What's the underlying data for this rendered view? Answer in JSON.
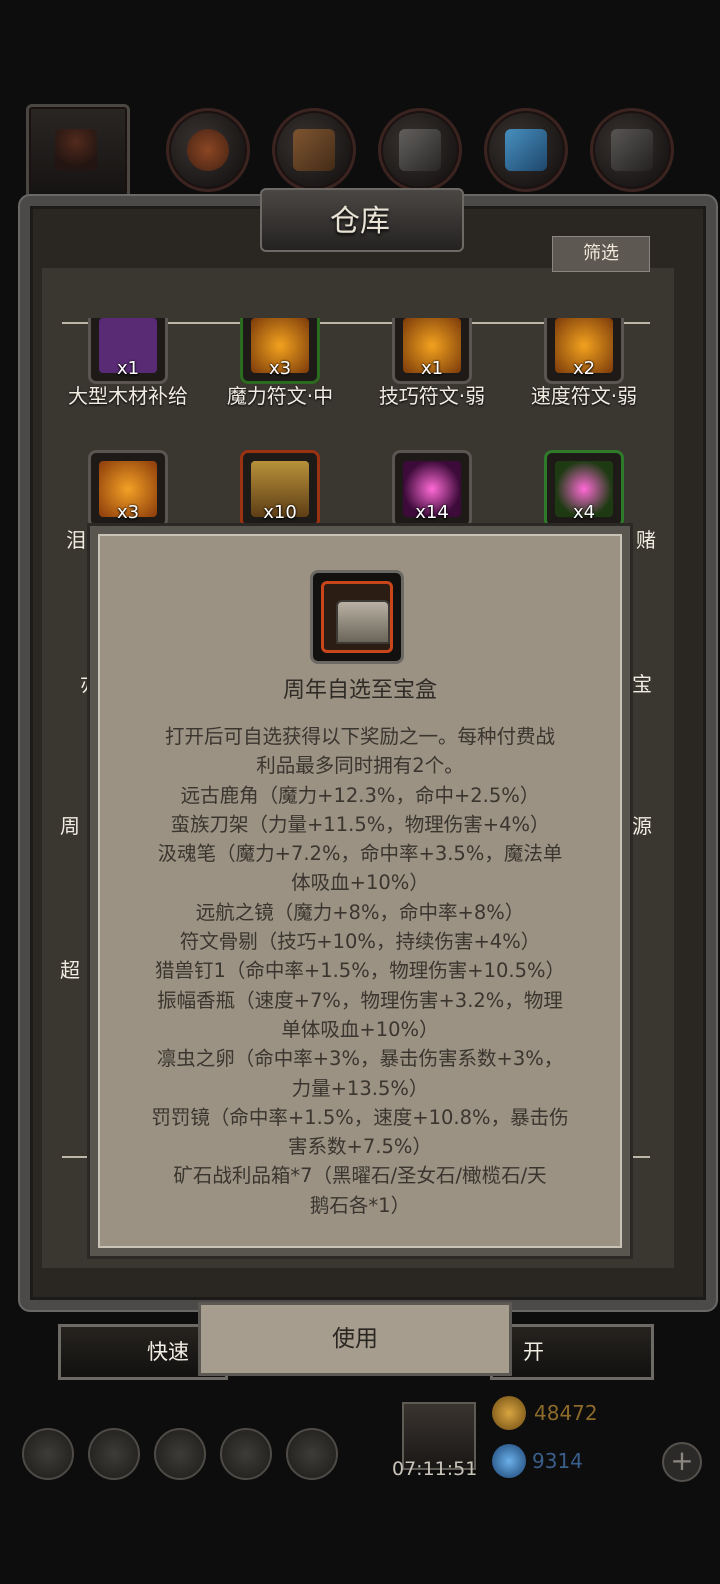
{
  "warehouse": {
    "title": "仓库",
    "filter_label": "筛选"
  },
  "tabs": [
    {
      "name": "tab-all",
      "icon": "hooded-figure-icon"
    },
    {
      "name": "tab-food",
      "icon": "food-icon"
    },
    {
      "name": "tab-wood",
      "icon": "wood-icon"
    },
    {
      "name": "tab-stone",
      "icon": "stone-icon"
    },
    {
      "name": "tab-crystal",
      "icon": "crystal-icon"
    },
    {
      "name": "tab-iron",
      "icon": "iron-icon"
    }
  ],
  "items_row1": [
    {
      "name": "大型木材补给",
      "count": "x1",
      "color": "#5a2b75"
    },
    {
      "name": "魔力符文·中",
      "count": "x3",
      "color": "#2b6b1f"
    },
    {
      "name": "技巧符文·弱",
      "count": "x1",
      "color": "#b36a18"
    },
    {
      "name": "速度符文·弱",
      "count": "x2",
      "color": "#b36a18"
    }
  ],
  "items_row2": [
    {
      "count": "x3",
      "color": "#b35c13"
    },
    {
      "count": "x10",
      "color": "#9a3212"
    },
    {
      "count": "x14",
      "color": "#6d1e6e"
    },
    {
      "count": "x4",
      "color": "#1f6b27"
    }
  ],
  "partial_labels": {
    "left1": "泪",
    "left2": "亦",
    "left3": "周",
    "left4": "超",
    "right1": "赌",
    "right2": "宝",
    "right3": "源"
  },
  "popup": {
    "title": "周年自选至宝盒",
    "description": "打开后可自选获得以下奖励之一。每种付费战利品最多同时拥有2个。\n远古鹿角（魔力+12.3%，命中+2.5%）\n蛮族刀架（力量+11.5%，物理伤害+4%）\n汲魂笔（魔力+7.2%，命中率+3.5%，魔法单体吸血+10%）\n远航之镜（魔力+8%，命中率+8%）\n符文骨剔（技巧+10%，持续伤害+4%）\n猎兽钉1（命中率+1.5%，物理伤害+10.5%）\n振幅香瓶（速度+7%，物理伤害+3.2%，物理单体吸血+10%）\n凛虫之卵（命中率+3%，暴击伤害系数+3%，力量+13.5%）\n罚罚镜（命中率+1.5%，速度+10.8%，暴击伤害系数+7.5%）\n矿石战利品箱*7（黑曜石/圣女石/橄榄石/天鹅石各*1）",
    "lines": [
      "打开后可自选获得以下奖励之一。每种付费战",
      "利品最多同时拥有2个。",
      "远古鹿角（魔力+12.3%，命中+2.5%）",
      "蛮族刀架（力量+11.5%，物理伤害+4%）",
      "汲魂笔（魔力+7.2%，命中率+3.5%，魔法单",
      "体吸血+10%）",
      "远航之镜（魔力+8%，命中率+8%）",
      "符文骨剔（技巧+10%，持续伤害+4%）",
      "猎兽钉1（命中率+1.5%，物理伤害+10.5%）",
      "振幅香瓶（速度+7%，物理伤害+3.2%，物理",
      "单体吸血+10%）",
      "凛虫之卵（命中率+3%，暴击伤害系数+3%，",
      "力量+13.5%）",
      "罚罚镜（命中率+1.5%，速度+10.8%，暴击伤",
      "害系数+7.5%）",
      "矿石战利品箱*7（黑曜石/圣女石/橄榄石/天",
      "鹅石各*1）"
    ],
    "use_label": "使用"
  },
  "bottom_buttons": {
    "left_label": "快速",
    "right_label": "开"
  },
  "hud": {
    "timer": "07:11:51",
    "gold": "48472",
    "gems": "9314"
  },
  "colors": {
    "gold": "#8c6a2a",
    "gem": "#3a5f8a",
    "accent_orange": "#c8461a"
  }
}
